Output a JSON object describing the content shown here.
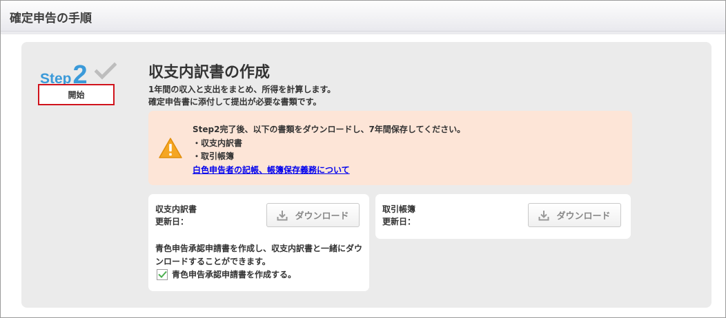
{
  "header": {
    "title": "確定申告の手順"
  },
  "step": {
    "word": "Step",
    "number": "2",
    "start_label": "開始"
  },
  "section": {
    "title": "収支内訳書の作成",
    "desc_line1": "1年間の収入と支出をまとめ、所得を計算します。",
    "desc_line2": "確定申告書に添付して提出が必要な書類です。"
  },
  "notice": {
    "line1": "Step2完了後、以下の書類をダウンロードし、7年間保存してください。",
    "item1": "・収支内訳書",
    "item2": "・取引帳簿",
    "link_text": "白色申告者の記帳、帳簿保存義務について"
  },
  "cards": {
    "left": {
      "name": "収支内訳書",
      "updated_label": "更新日：",
      "download_label": "ダウンロード",
      "note": "青色申告承認申請書を作成し、収支内訳書と一緒にダウンロードすることができます。",
      "checkbox_label": "青色申告承認申請書を作成する。",
      "checkbox_checked": true
    },
    "right": {
      "name": "取引帳簿",
      "updated_label": "更新日：",
      "download_label": "ダウンロード"
    }
  },
  "colors": {
    "accent": "#3b9ad9",
    "highlight_border": "#d0121b",
    "notice_bg": "#fde5d7",
    "warning": "#f5a623",
    "check": "#4caf50"
  }
}
